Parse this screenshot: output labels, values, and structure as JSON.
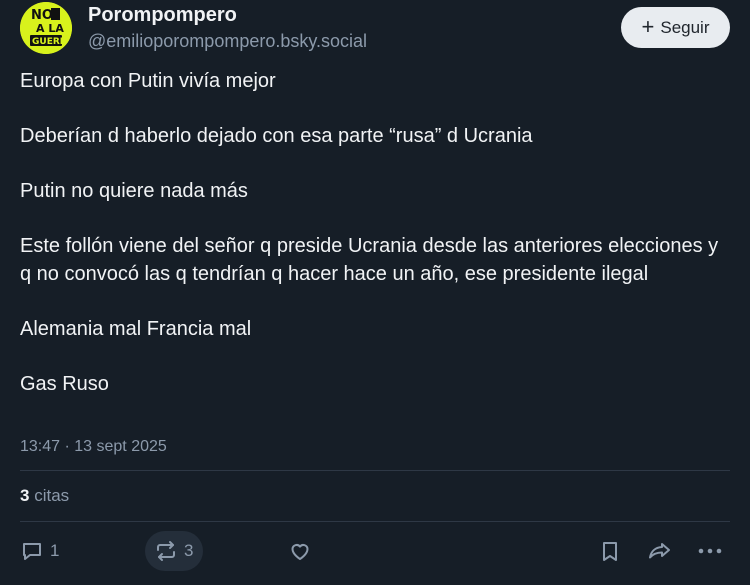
{
  "author": {
    "display_name": "Porompompero",
    "handle": "@emilioporompompero.bsky.social",
    "avatar_text": "NO A LA GUERRA"
  },
  "follow_button": {
    "label": "Seguir",
    "icon": "plus-icon"
  },
  "post": {
    "paragraphs": [
      "Europa con Putin vivía mejor",
      "Deberían d haberlo dejado con esa parte “rusa” d Ucrania",
      "Putin no quiere nada más",
      "Este follón viene del señor q preside Ucrania desde las anteriores elecciones y q no convocó las q tendrían q hacer hace un año, ese presidente ilegal",
      "Alemania mal Francia mal",
      "Gas Ruso"
    ],
    "timestamp": "13:47 · 13 sept 2025"
  },
  "stats": {
    "quotes_count": "3",
    "quotes_label": "citas"
  },
  "actions": {
    "reply_count": "1",
    "repost_count": "3",
    "like_icon": "heart-icon",
    "bookmark_icon": "bookmark-icon",
    "share_icon": "share-icon",
    "more_icon": "more-icon"
  },
  "colors": {
    "background": "#161e27",
    "text": "#f1f3f5",
    "muted": "#8c9aab",
    "avatar": "#d8f21c",
    "button_bg": "#e8ecf0"
  }
}
